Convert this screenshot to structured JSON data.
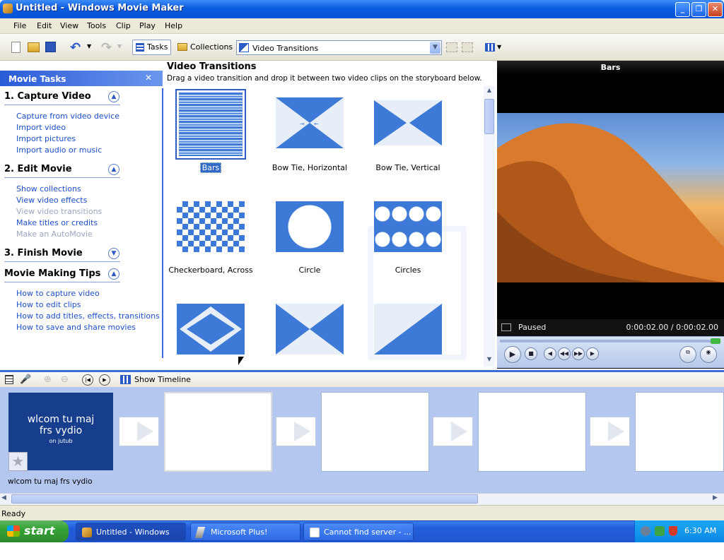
{
  "window": {
    "title": "Untitled - Windows Movie Maker"
  },
  "menu": [
    "File",
    "Edit",
    "View",
    "Tools",
    "Clip",
    "Play",
    "Help"
  ],
  "toolbar": {
    "tasks_label": "Tasks",
    "collections_label": "Collections",
    "collection_selected": "Video Transitions"
  },
  "taskpane": {
    "header": "Movie Tasks",
    "sections": [
      {
        "title": "1. Capture Video",
        "links": [
          "Capture from video device",
          "Import video",
          "Import pictures",
          "Import audio or music"
        ]
      },
      {
        "title": "2. Edit Movie",
        "links": [
          "Show collections",
          "View video effects",
          "View video transitions",
          "Make titles or credits",
          "Make an AutoMovie"
        ]
      },
      {
        "title": "3. Finish Movie",
        "links": []
      },
      {
        "title": "Movie Making Tips",
        "links": [
          "How to capture video",
          "How to edit clips",
          "How to add titles, effects, transitions",
          "How to save and share movies"
        ]
      }
    ]
  },
  "content": {
    "title": "Video Transitions",
    "subtitle": "Drag a video transition and drop it between two video clips on the storyboard below.",
    "transitions": [
      "Bars",
      "Bow Tie, Horizontal",
      "Bow Tie, Vertical",
      "Checkerboard, Across",
      "Circle",
      "Circles"
    ]
  },
  "preview": {
    "title": "Bars",
    "status": "Paused",
    "time": "0:00:02.00 / 0:00:02.00"
  },
  "storyboard": {
    "show_timeline_label": "Show Timeline",
    "clip": {
      "title_line1": "wlcom tu maj",
      "title_line2": "frs vydio",
      "subtitle": "on jutub",
      "label": "wlcom tu maj frs vydio"
    }
  },
  "status": {
    "text": "Ready"
  },
  "taskbar": {
    "start_label": "start",
    "items": [
      "Untitled - Windows M...",
      "Microsoft Plus!",
      "Cannot find server - ..."
    ],
    "clock": "6:30 AM"
  },
  "colors": {
    "accent": "#3b6fd8",
    "titlebar": "#0a5be0",
    "transition_blue": "#3d79d6",
    "taskbar": "#245edb",
    "start_green": "#35a235"
  }
}
